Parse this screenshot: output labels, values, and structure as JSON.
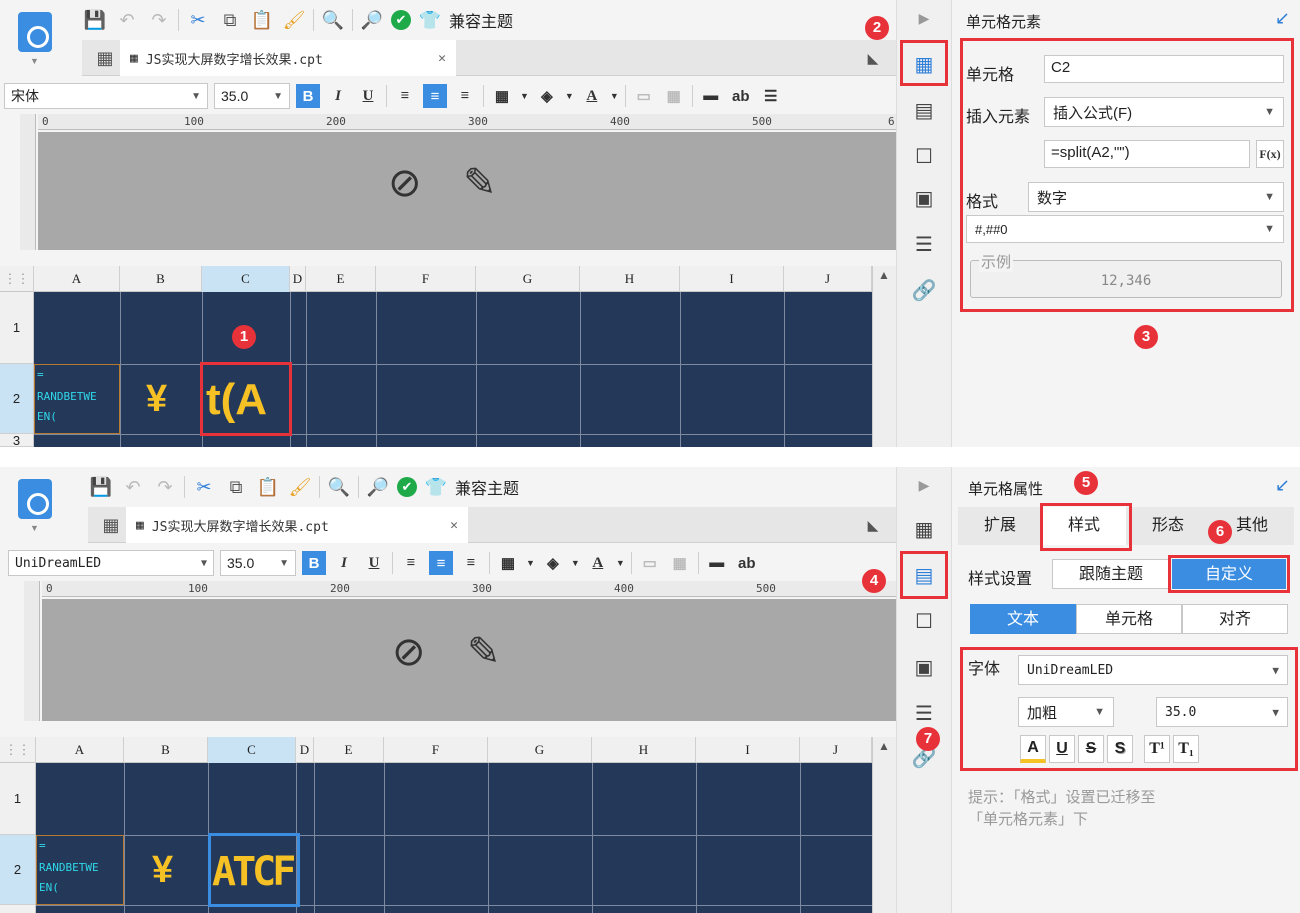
{
  "common": {
    "compat_theme": "兼容主题",
    "file_tab": "JS实现大屏数字增长效果.cpt",
    "font_size": "35.0",
    "columns": [
      "A",
      "B",
      "C",
      "D",
      "E",
      "F",
      "G",
      "H",
      "I",
      "J"
    ],
    "rows": [
      "1",
      "2",
      "3"
    ],
    "ruler_ticks": [
      "0",
      "100",
      "200",
      "300",
      "400",
      "500",
      "6"
    ],
    "a2_line1": "=",
    "a2_line2": "RANDBETWE",
    "a2_line3": "EN(",
    "b2": "¥",
    "close_x": "✕",
    "format_bold": "B",
    "format_italic": "I",
    "format_underline": "U",
    "ab_label": "ab"
  },
  "top": {
    "font_name": "宋体",
    "c2_text": "t(A",
    "panel_title": "单元格元素",
    "cell_label": "单元格",
    "cell_value": "C2",
    "insert_label": "插入元素",
    "insert_value": "插入公式(F)",
    "formula_value": "=split(A2,\"\")",
    "fx_label": "F(x)",
    "format_label": "格式",
    "format_value": "数字",
    "pattern_value": "#,##0",
    "example_legend": "示例",
    "example_value": "12,346",
    "badges": [
      "1",
      "2",
      "3"
    ]
  },
  "bottom": {
    "font_name": "UniDreamLED",
    "c2_text": "ATCF",
    "panel_title": "单元格属性",
    "tabs": [
      "扩展",
      "样式",
      "形态",
      "其他"
    ],
    "style_setting_label": "样式设置",
    "follow_theme": "跟随主题",
    "custom": "自定义",
    "subtabs": [
      "文本",
      "单元格",
      "对齐"
    ],
    "font_label": "字体",
    "font_value": "UniDreamLED",
    "weight_value": "加粗",
    "size_value": "35.0",
    "style_buttons": [
      "A",
      "U",
      "S",
      "S",
      "T¹",
      "T₁"
    ],
    "hint": "提示：「格式」设置已迁移至「单元格元素」下",
    "badges": [
      "4",
      "5",
      "6",
      "7"
    ]
  }
}
